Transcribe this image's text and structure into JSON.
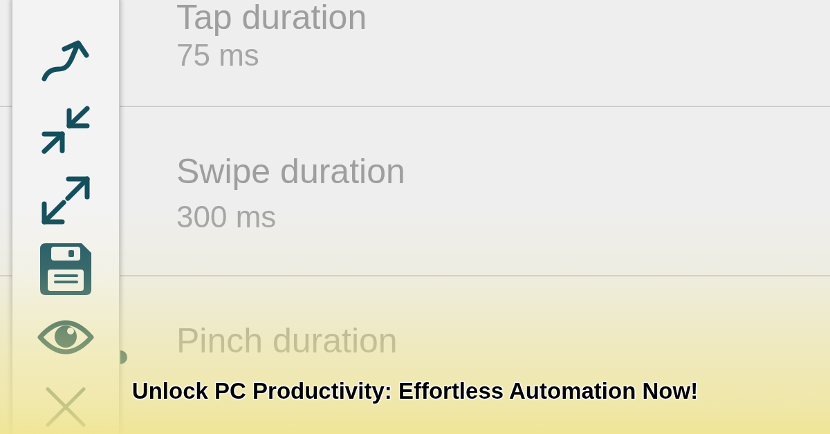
{
  "settings": [
    {
      "title": "Tap duration",
      "value": "75 ms"
    },
    {
      "title": "Swipe duration",
      "value": "300 ms"
    },
    {
      "title": "Pinch duration"
    }
  ],
  "caption": "Unlock PC Productivity: Effortless Automation Now!"
}
